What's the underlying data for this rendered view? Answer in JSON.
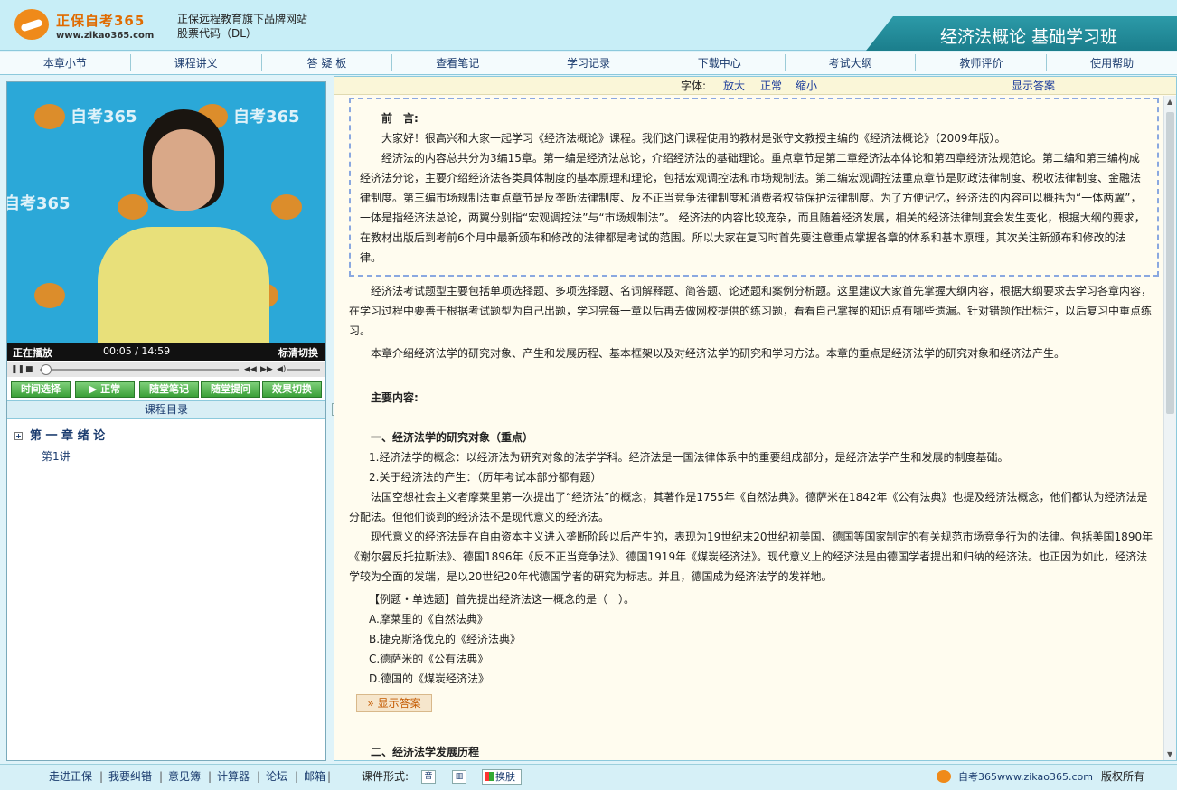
{
  "header": {
    "brand": "正保自考365",
    "url": "www.zikao365.com",
    "tagline1": "正保远程教育旗下品牌网站",
    "tagline2": "股票代码（DL）",
    "course_title": "经济法概论 基础学习班"
  },
  "nav": [
    "本章小节",
    "课程讲义",
    "答 疑 板",
    "查看笔记",
    "学习记录",
    "下载中心",
    "考试大纲",
    "教师评价",
    "使用帮助"
  ],
  "player": {
    "watermark": "自考365",
    "status": "正在播放",
    "time_current": "00:05",
    "time_total": "14:59",
    "mode": "标清切换",
    "progress": 0.006,
    "buttons": [
      "时间选择",
      "▶ 正常",
      "随堂笔记",
      "随堂提问",
      "效果切换"
    ]
  },
  "toc": {
    "heading": "课程目录",
    "chapter": "第 一 章 绪 论",
    "lesson": "第1讲"
  },
  "toolbar": {
    "font_label": "字体:",
    "font_options": [
      "放大",
      "正常",
      "缩小"
    ],
    "show_answer": "显示答案"
  },
  "content": {
    "preface_title": "前　言:",
    "preface_p1": "大家好！很高兴和大家一起学习《经济法概论》课程。我们这门课程使用的教材是张守文教授主编的《经济法概论》（2009年版）。",
    "preface_p2": "经济法的内容总共分为3编15章。第一编是经济法总论，介绍经济法的基础理论。重点章节是第二章经济法本体论和第四章经济法规范论。第二编和第三编构成经济法分论，主要介绍经济法各类具体制度的基本原理和理论，包括宏观调控法和市场规制法。第二编宏观调控法重点章节是财政法律制度、税收法律制度、金融法律制度。第三编市场规制法重点章节是反垄断法律制度、反不正当竞争法律制度和消费者权益保护法律制度。为了方便记忆，经济法的内容可以概括为“一体两翼”，一体是指经济法总论，两翼分别指“宏观调控法”与“市场规制法”。 经济法的内容比较庞杂，而且随着经济发展，相关的经济法律制度会发生变化，根据大纲的要求，在教材出版后到考前6个月中最新颁布和修改的法律都是考试的范围。所以大家在复习时首先要注意重点掌握各章的体系和基本原理，其次关注新颁布和修改的法律。",
    "para_exam": "经济法考试题型主要包括单项选择题、多项选择题、名词解释题、简答题、论述题和案例分析题。这里建议大家首先掌握大纲内容，根据大纲要求去学习各章内容，在学习过程中要善于根据考试题型为自己出题，学习完每一章以后再去做网校提供的练习题，看看自己掌握的知识点有哪些遗漏。针对错题作出标注，以后复习中重点练习。",
    "para_intro": "本章介绍经济法学的研究对象、产生和发展历程、基本框架以及对经济法学的研究和学习方法。本章的重点是经济法学的研究对象和经济法产生。",
    "main_heading": "主要内容:",
    "section1": "一、经济法学的研究对象（重点）",
    "item1": "1.经济法学的概念：以经济法为研究对象的法学学科。经济法是一国法律体系中的重要组成部分，是经济法学产生和发展的制度基础。",
    "item2": "2.关于经济法的产生：（历年考试本部分都有题）",
    "para_france": "法国空想社会主义者摩莱里第一次提出了“经济法”的概念，其著作是1755年《自然法典》。德萨米在1842年《公有法典》也提及经济法概念，他们都认为经济法是分配法。但他们谈到的经济法不是现代意义的经济法。",
    "para_modern": "现代意义的经济法是在自由资本主义进入垄断阶段以后产生的，表现为19世纪末20世纪初美国、德国等国家制定的有关规范市场竞争行为的法律。包括美国1890年《谢尔曼反托拉斯法》、德国1896年《反不正当竞争法》、德国1919年《煤炭经济法》。现代意义上的经济法是由德国学者提出和归纳的经济法。也正因为如此，经济法学较为全面的发端，是以20世纪20年代德国学者的研究为标志。并且，德国成为经济法学的发祥地。",
    "example_q": "【例题・单选题】首先提出经济法这一概念的是（　）。",
    "options": [
      "A.摩莱里的《自然法典》",
      "B.捷克斯洛伐克的《经济法典》",
      "C.德萨米的《公有法典》",
      "D.德国的《煤炭经济法》"
    ],
    "show_answer_btn": "» 显示答案",
    "section2": "二、经济法学发展历程"
  },
  "footer": {
    "links": [
      "走进正保",
      "我要纠错",
      "意见簿",
      "计算器",
      "论坛",
      "邮箱"
    ],
    "form_label": "课件形式:",
    "skin": "换肤",
    "site": "自考365www.zikao365.com",
    "copyright": "版权所有"
  },
  "colors": {
    "accent": "#1b7e8c",
    "brand_orange": "#ef8a1a",
    "content_bg": "#fffcef",
    "link": "#1a3b9a"
  }
}
